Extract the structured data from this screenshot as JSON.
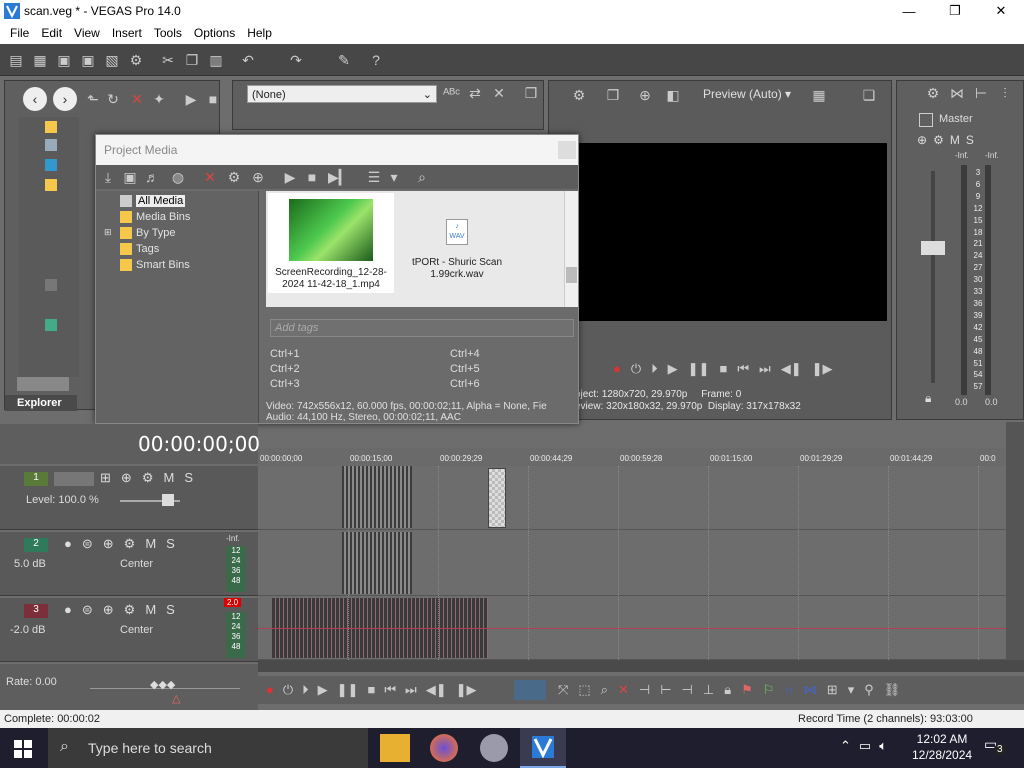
{
  "window": {
    "title": "scan.veg * - VEGAS Pro 14.0",
    "controls": {
      "minimize": "—",
      "maximize": "❐",
      "close": "✕"
    }
  },
  "menu": [
    "File",
    "Edit",
    "View",
    "Insert",
    "Tools",
    "Options",
    "Help"
  ],
  "explorer": {
    "tab_label": "Explorer"
  },
  "trimmer_toolbar": {
    "dropdown_value": "(None)"
  },
  "project_media": {
    "title": "Project Media",
    "tree": [
      "All Media",
      "Media Bins",
      "By Type",
      "Tags",
      "Smart Bins"
    ],
    "files": [
      {
        "name": "ScreenRecording_12-28-2024 11-42-18_1.mp4"
      },
      {
        "name": "tPORt - Shuric Scan 1.99crk.wav",
        "icon_label": "WAV"
      }
    ],
    "tags_placeholder": "Add tags",
    "shortcuts": [
      "Ctrl+1",
      "Ctrl+4",
      "Ctrl+2",
      "Ctrl+5",
      "Ctrl+3",
      "Ctrl+6"
    ],
    "info_video": "Video: 742x556x12, 60.000 fps, 00:00:02;11, Alpha = None, Fie",
    "info_audio": "Audio: 44,100 Hz, Stereo, 00:00:02;11, AAC"
  },
  "preview": {
    "mode": "Preview (Auto)",
    "project_label": "oject:",
    "project_value": "1280x720, 29.970p",
    "frame_label": "Frame:",
    "frame_value": "0",
    "preview_label": "eview:",
    "preview_value": "320x180x32, 29.970p",
    "display_label": "Display:",
    "display_value": "317x178x32"
  },
  "master": {
    "label": "Master",
    "inf_l": "-Inf.",
    "inf_r": "-Inf.",
    "scale": [
      "3",
      "6",
      "9",
      "12",
      "15",
      "18",
      "21",
      "24",
      "27",
      "30",
      "33",
      "36",
      "39",
      "42",
      "45",
      "48",
      "51",
      "54",
      "57"
    ],
    "value_l": "0.0",
    "value_r": "0.0"
  },
  "timeline": {
    "timecode": "00:00:00;00",
    "ruler": [
      "00:00:00;00",
      "00:00:15;00",
      "00:00:29;29",
      "00:00:44;29",
      "00:00:59;28",
      "00:01:15;00",
      "00:01:29;29",
      "00:01:44;29",
      "00:0"
    ],
    "tracks": [
      {
        "num": "1",
        "level": "Level: 100.0 %",
        "color": "#5a7a3a"
      },
      {
        "num": "2",
        "volume": "5.0 dB",
        "pan": "Center",
        "meter_top": "-Inf.",
        "color": "#2f7a5a"
      },
      {
        "num": "3",
        "volume": "-2.0 dB",
        "pan": "Center",
        "meter_top": "2.0",
        "color": "#7a2f3a"
      }
    ],
    "meter_scale": [
      "12",
      "24",
      "36",
      "48"
    ],
    "mute": "M",
    "solo": "S",
    "rate": "Rate: 0.00"
  },
  "status": {
    "left": "Complete: 00:00:02",
    "right": "Record Time (2 channels): 93:03:00"
  },
  "taskbar": {
    "search_placeholder": "Type here to search",
    "time": "12:02 AM",
    "date": "12/28/2024",
    "notifications": "3"
  }
}
